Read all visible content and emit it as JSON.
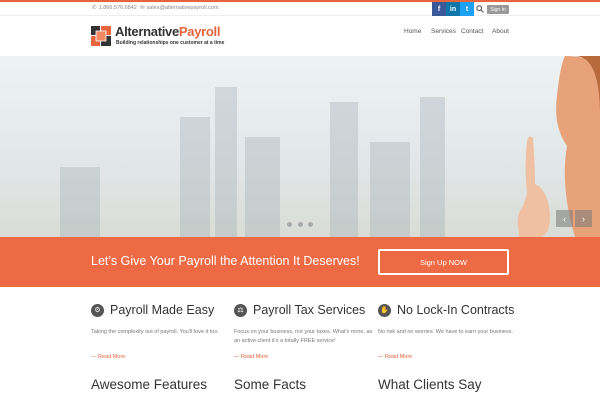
{
  "topbar": {
    "phone": "1.866.576.6842",
    "email": "sales@alternativepayroll.com",
    "social": [
      "f",
      "in",
      "t"
    ],
    "signin_label": "Sign In"
  },
  "header": {
    "logo_main": "Alternative",
    "logo_accent": "Payroll",
    "tagline": "Building relationships one customer at a time",
    "nav": [
      "Home",
      "Services",
      "Contact",
      "About"
    ]
  },
  "hero": {
    "prev_symbol": "‹",
    "next_symbol": "›",
    "slides": 3
  },
  "cta": {
    "text": "Let’s Give Your Payroll the Attention It Deserves!",
    "button": "Sign Up NOW"
  },
  "features": [
    {
      "title": "Payroll Made Easy",
      "icon": "gear-icon",
      "desc": "Taking the complexity out of payroll. You'll love it too.",
      "link": "— Read More"
    },
    {
      "title": "Payroll Tax Services",
      "icon": "gavel-icon",
      "desc": "Focus on your business, not your taxes.  What's more, as an active client it's a totally FREE service!",
      "link": "— Read More"
    },
    {
      "title": "No Lock-In Contracts",
      "icon": "handshake-icon",
      "desc": "No risk and no worries.  We have to earn your business.",
      "link": "— Read More"
    }
  ],
  "sections": [
    "Awesome Features",
    "Some Facts",
    "What Clients Say"
  ],
  "colors": {
    "accent": "#e8643c",
    "cta_bg": "#ee6a45"
  }
}
